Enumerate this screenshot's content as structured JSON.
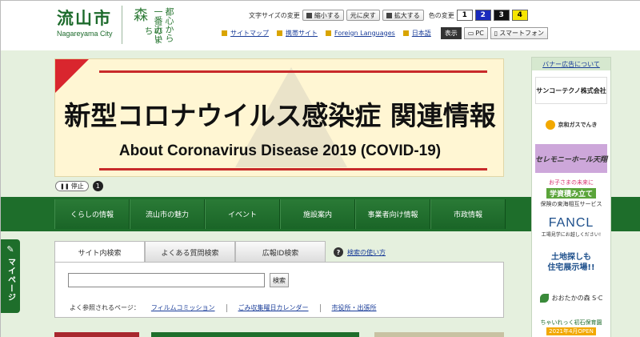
{
  "header": {
    "logo_jp": "流山市",
    "logo_en": "Nagareyama City",
    "tagline_mori": "森",
    "tagline_col1": "都心から",
    "tagline_col2": "一番近い",
    "tagline_col3": "のまち"
  },
  "toolbar": {
    "font_size_label": "文字サイズの変更",
    "shrink": "縮小する",
    "reset": "元に戻す",
    "enlarge": "拡大する",
    "color_label": "色の変更",
    "colors": [
      {
        "label": "1",
        "bg": "#ffffff",
        "fg": "#000000"
      },
      {
        "label": "2",
        "bg": "#1a2bbd",
        "fg": "#ffffff"
      },
      {
        "label": "3",
        "bg": "#111111",
        "fg": "#ffffff"
      },
      {
        "label": "4",
        "bg": "#f6e500",
        "fg": "#000000"
      }
    ],
    "links": [
      "サイトマップ",
      "携帯サイト",
      "Foreign Languages",
      "日本語"
    ],
    "display_label": "表示",
    "pc": "PC",
    "smartphone": "スマートフォン"
  },
  "banner": {
    "title": "新型コロナウイルス感染症 関連情報",
    "subtitle": "About Coronavirus Disease 2019 (COVID-19)",
    "stop": "停止",
    "slide_number": "1"
  },
  "nav": [
    "くらしの情報",
    "流山市の魅力",
    "イベント",
    "施設案内",
    "事業者向け情報",
    "市政情報"
  ],
  "search": {
    "tabs": [
      "サイト内検索",
      "よくある質問検索",
      "広報ID検索"
    ],
    "help": "検索の使い方",
    "input_value": "",
    "button": "検索",
    "freq_label": "よく参照されるページ：",
    "freq_links": [
      "フィルムコミッション",
      "ごみ収集曜日カレンダー",
      "市役所・出張所"
    ]
  },
  "sidebar": {
    "header": "バナー広告について",
    "ads": {
      "sanko": "サンコーテクノ株式会社",
      "keiwa": "京和ガスでんき",
      "ceremony": "セレモニーホール天翔",
      "tokai_a": "お子さまの未来に",
      "tokai_b": "学資積み立て",
      "tokai_c": "保険の東海相互サービス",
      "fancl_a": "FANCL",
      "fancl_b": "工場見学にお越しください!",
      "tochi_a": "土地探しも",
      "tochi_b": "住宅展示場!!",
      "otaka": "おおたかの森 S·C",
      "chiirekko_a": "ちゃいれっく初石保育園",
      "chiirekko_b": "2021年4月OPEN"
    }
  },
  "mypage": "マイページ"
}
